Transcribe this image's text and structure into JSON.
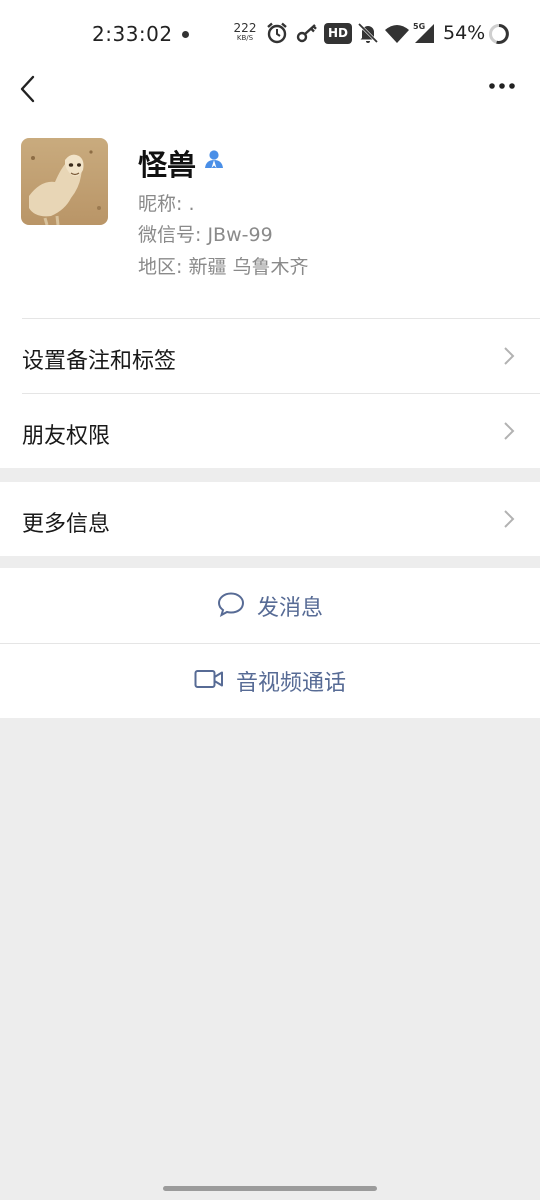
{
  "status_bar": {
    "time": "2:33:02",
    "net_speed": "222",
    "net_speed_unit": "KB/S",
    "hd": "HD",
    "signal_type": "5G",
    "battery": "54%"
  },
  "profile": {
    "name": "怪兽",
    "nickname": "昵称: .",
    "wechat_id": "微信号: JBw-99",
    "region": "地区: 新疆  乌鲁木齐"
  },
  "menu": {
    "remark_tags": "设置备注和标签",
    "friend_permissions": "朋友权限",
    "more_info": "更多信息"
  },
  "actions": {
    "send_message": "发消息",
    "video_call": "音视频通话"
  },
  "colors": {
    "accent_link": "#576b95",
    "verify_blue": "#4a8fe7",
    "background": "#ededed"
  }
}
